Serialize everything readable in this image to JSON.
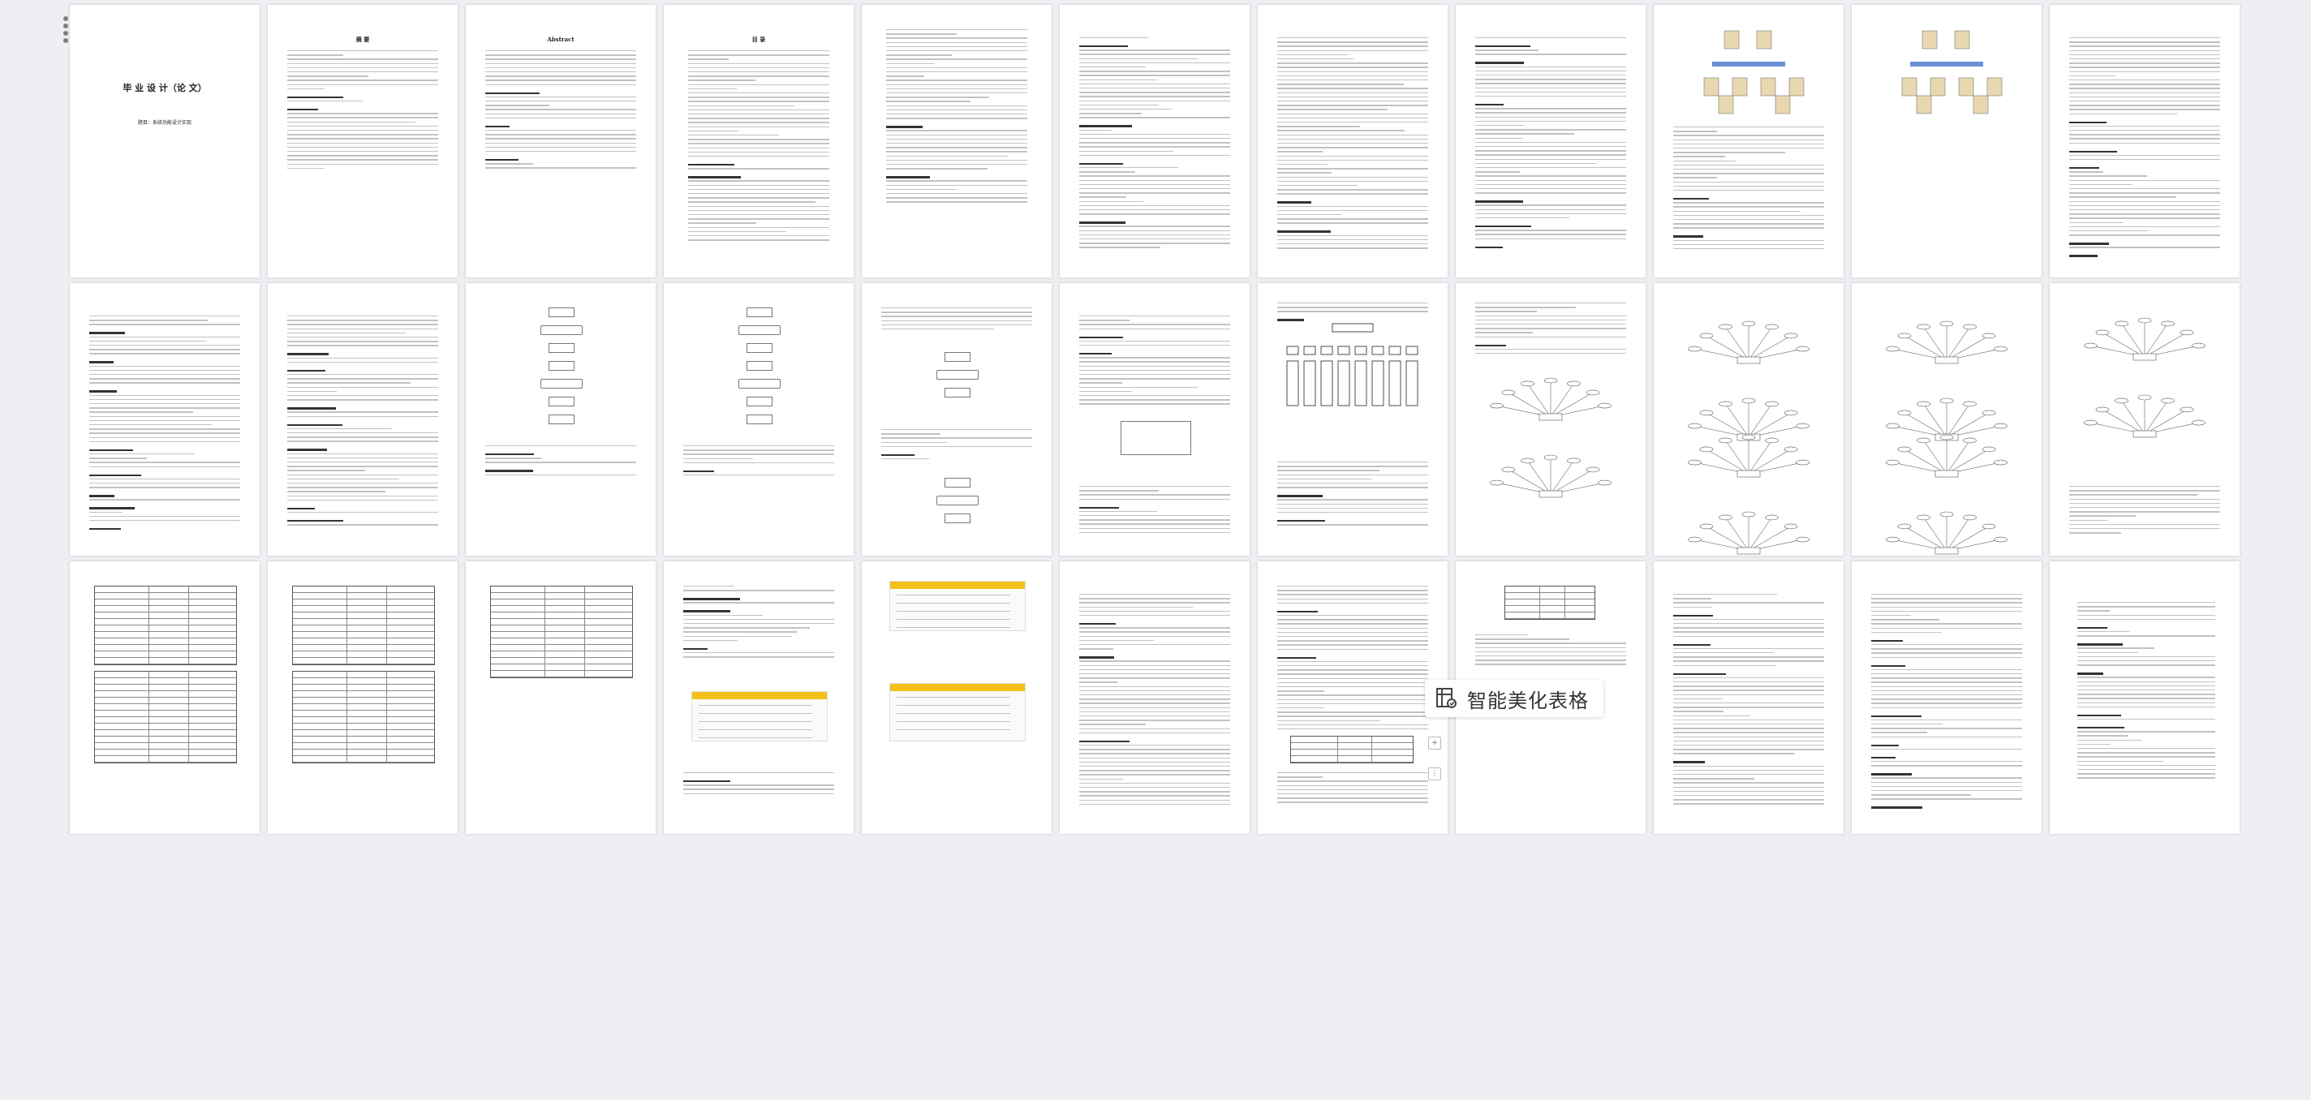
{
  "toolbar": {
    "grid_icon": "grid-dots-icon"
  },
  "popup": {
    "label": "智能美化表格",
    "icon": "table-beautify-icon"
  },
  "cover": {
    "title": "毕 业 设 计（论 文）",
    "subtitle": "题目：系统功能设计实现"
  },
  "abstract_cn_title": "摘 要",
  "abstract_en_title": "Abstract",
  "toc_title": "目 录",
  "colors": {
    "background": "#eeeff2",
    "page": "#ffffff",
    "screenshot_bar": "#f3c01a"
  }
}
